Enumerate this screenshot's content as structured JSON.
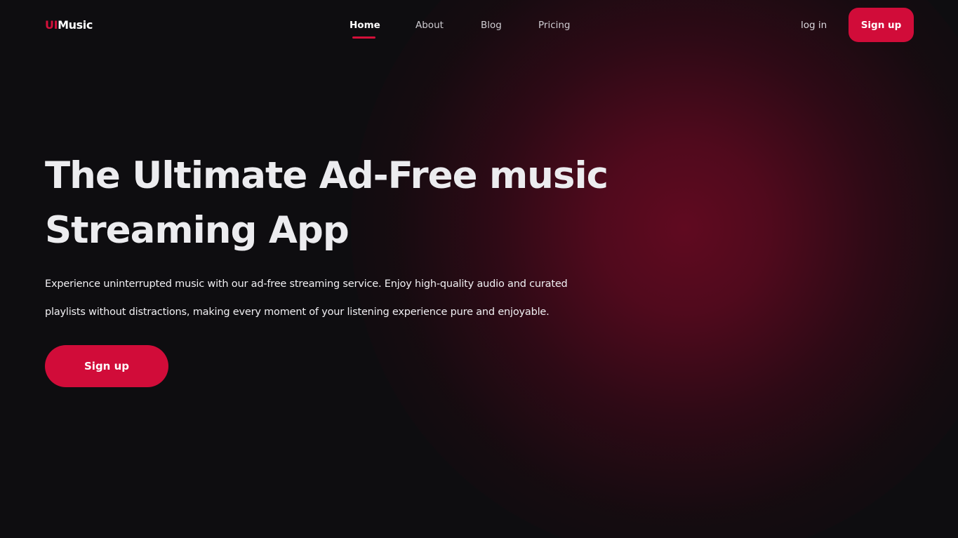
{
  "brand": {
    "prefix": "UI",
    "name": "Music",
    "accent_color": "#d10c39"
  },
  "nav": {
    "items": [
      {
        "label": "Home",
        "active": true
      },
      {
        "label": "About",
        "active": false
      },
      {
        "label": "Blog",
        "active": false
      },
      {
        "label": "Pricing",
        "active": false
      }
    ]
  },
  "header": {
    "login_label": "log in",
    "signup_label": "Sign up"
  },
  "hero": {
    "title_line1": "The Ultimate Ad-Free music",
    "title_line2": "Streaming App",
    "description": "Experience uninterrupted music with our ad-free streaming service. Enjoy high-quality audio and curated playlists without distractions, making every moment of your listening experience pure and enjoyable.",
    "cta_label": "Sign up"
  },
  "colors": {
    "background": "#0e0d10",
    "glow": "#600a20",
    "text": "#ffffff"
  }
}
